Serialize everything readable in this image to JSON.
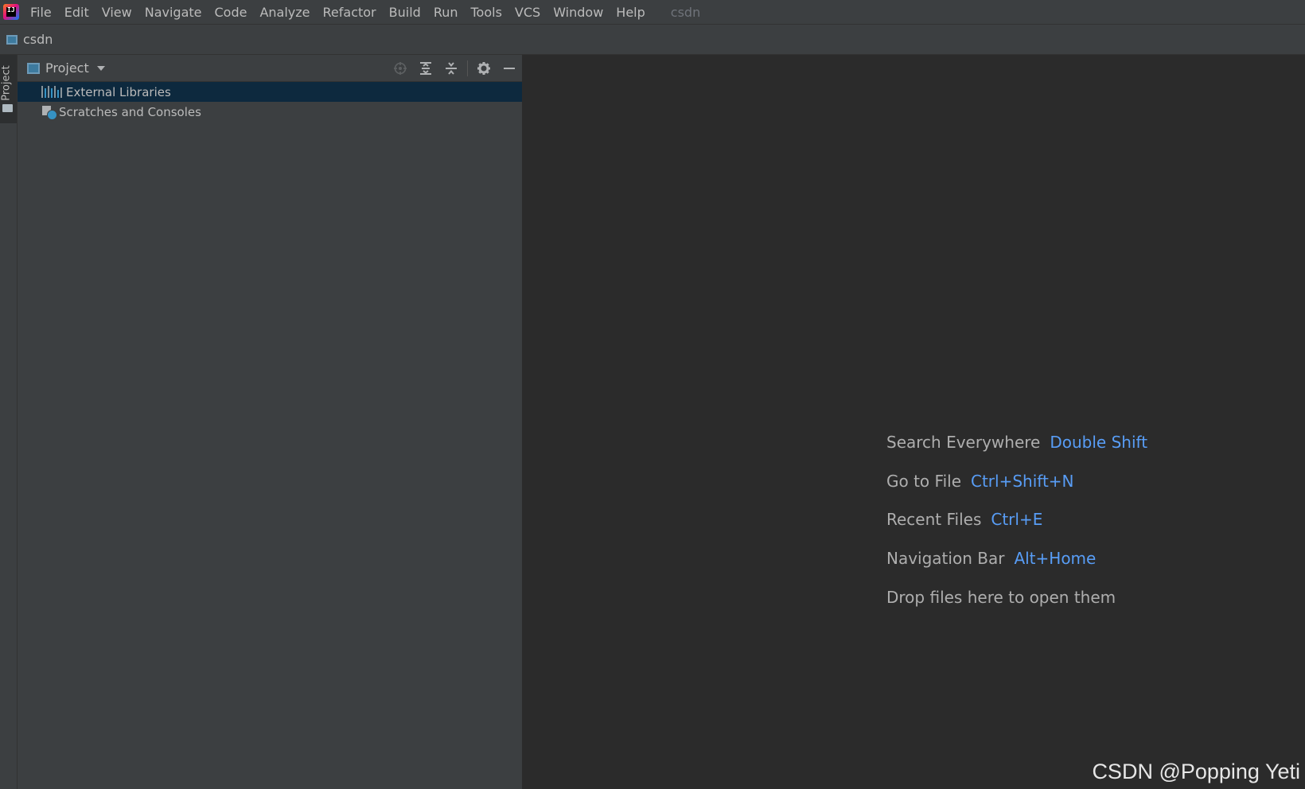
{
  "menu": {
    "items": [
      "File",
      "Edit",
      "View",
      "Navigate",
      "Code",
      "Analyze",
      "Refactor",
      "Build",
      "Run",
      "Tools",
      "VCS",
      "Window",
      "Help"
    ],
    "project_name": "csdn"
  },
  "navbar": {
    "module": "csdn"
  },
  "tool_strip": {
    "project_tab": "Project"
  },
  "project_panel": {
    "title": "Project",
    "tools": [
      "locate-icon",
      "expand-all-icon",
      "collapse-all-icon",
      "gear-icon",
      "minimize-icon"
    ],
    "tree": [
      {
        "label": "External Libraries",
        "icon": "library-icon",
        "selected": true
      },
      {
        "label": "Scratches and Consoles",
        "icon": "scratches-icon",
        "selected": false
      }
    ]
  },
  "editor": {
    "hints": [
      {
        "label": "Search Everywhere",
        "key": "Double Shift"
      },
      {
        "label": "Go to File",
        "key": "Ctrl+Shift+N"
      },
      {
        "label": "Recent Files",
        "key": "Ctrl+E"
      },
      {
        "label": "Navigation Bar",
        "key": "Alt+Home"
      }
    ],
    "drop_text": "Drop files here to open them"
  },
  "watermark": "CSDN @Popping Yeti",
  "colors": {
    "panel_bg": "#3c3f41",
    "editor_bg": "#2b2b2b",
    "selection": "#0d293e",
    "shortcut": "#589df6"
  }
}
